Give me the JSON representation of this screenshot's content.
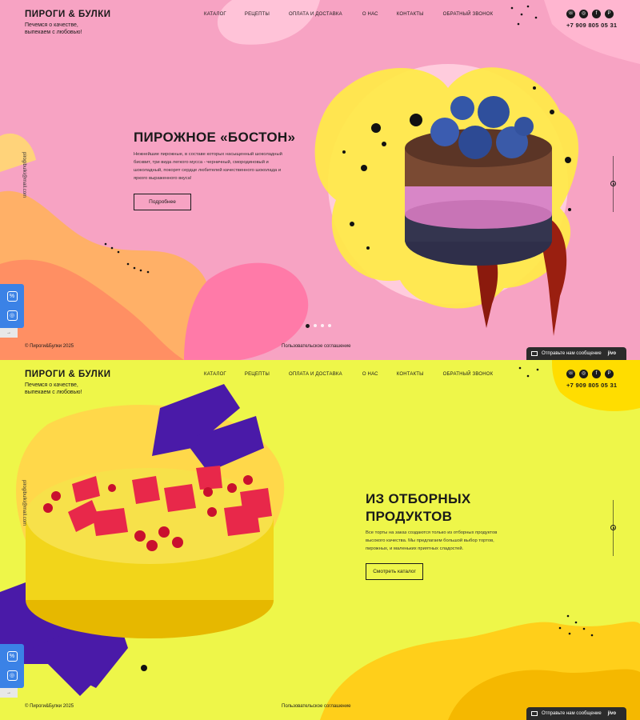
{
  "header": {
    "logo": "ПИРОГИ & БУЛКИ",
    "tagline": "Печемся о качестве, выпекаем с любовью!",
    "nav": [
      "КАТАЛОГ",
      "РЕЦЕПТЫ",
      "ОПЛАТА И ДОСТАВКА",
      "О НАС",
      "КОНТАКТЫ",
      "ОБРАТНЫЙ ЗВОНОК"
    ],
    "socials": [
      "whatsapp-icon",
      "instagram-icon",
      "facebook-icon",
      "pinterest-icon"
    ],
    "phone": "+7 909 805 05 31"
  },
  "slide1": {
    "title": "ПИРОЖНОЕ «БОСТОН»",
    "text": "Нежнейшие пирожные, в составе которых насыщенный шоколадный бисквит, три вида легкого мусса - черничный, смородиновый и шоколадный, покорят сердце любителей качественного шоколада и яркого выраженного вкуса!",
    "button": "Подробнее",
    "email": "pirogibulki@mail.com",
    "copyright": "© Пироги&Булки 2025",
    "policy": "Пользовательское соглашение",
    "chat": "Отправьте нам сообщение",
    "chat_brand": "jivo"
  },
  "slide2": {
    "title": "ИЗ ОТБОРНЫХ ПРОДУКТОВ",
    "text": "Все торты на заказ создаются только из отборных продуктов высокого качества. Мы предлагаем большой выбор тортов, пирожных, и маленьких приятных сладостей.",
    "button": "Смотреть каталог",
    "email": "pirogibulki@mail.com",
    "copyright": "© Пироги&Булки 2025",
    "policy": "Пользовательское соглашение",
    "chat": "Отправьте нам сообщение",
    "chat_brand": "jivo"
  },
  "colors": {
    "pink": "#f7a3c3",
    "yellow": "#eef649",
    "accent_blue": "#3b82e6",
    "dark": "#1a1a1a"
  }
}
